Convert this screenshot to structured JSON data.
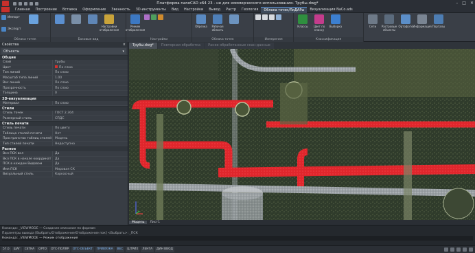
{
  "window": {
    "title": "Платформа nanoCAD x64 23 - не для коммерческого использования- Трубы.dwg*",
    "minimize": "–",
    "maximize": "□",
    "close": "✕"
  },
  "menu": {
    "tabs": [
      "Главная",
      "Построение",
      "Вставка",
      "Оформление",
      "Звенность",
      "3D-инструменты",
      "Вид",
      "Настройки",
      "Вывод",
      "Растр",
      "Геология",
      "Облака точек/ЛиДАРы",
      "Визуализация NaCo.ads"
    ],
    "active_index": 11
  },
  "ribbon": {
    "groups": [
      {
        "title": "Облака точек",
        "buttons": [
          "Импорт",
          "Экспорт",
          "Облако точек",
          "Менеджер облаков",
          "",
          ""
        ]
      },
      {
        "title": "Базовые вид",
        "buttons": [
          "Настройки отображения",
          "",
          "",
          ""
        ]
      },
      {
        "title": "Настройки",
        "buttons": [
          "Режим отображения",
          "",
          ""
        ]
      },
      {
        "title": "Облака точек",
        "buttons": [
          "Обрезка",
          "Рабочая область",
          "Сечения"
        ]
      },
      {
        "title": "Измерения",
        "buttons": [
          "",
          "",
          ""
        ]
      },
      {
        "title": "Классификация",
        "buttons": [
          "Классы",
          "Цвет по классу",
          "Выборка"
        ]
      },
      {
        "title": "",
        "buttons": [
          "Сети",
          "Растровые объекты",
          "Ортофото",
          "Информация",
          "Порталы"
        ]
      }
    ]
  },
  "properties": {
    "header": "Свойства",
    "selection": "Объекты",
    "selection_value": "Трубы",
    "sections": [
      {
        "title": "Общие",
        "rows": [
          {
            "key": "Слой",
            "value": "Трубы"
          },
          {
            "key": "Цвет",
            "value": "По слою"
          },
          {
            "key": "Тип линий",
            "value": "По слою"
          },
          {
            "key": "Масштаб типа линий",
            "value": "1.00"
          },
          {
            "key": "Вес линий",
            "value": "По слою"
          },
          {
            "key": "Прозрачность",
            "value": "По слою"
          },
          {
            "key": "Толщина",
            "value": "0"
          }
        ]
      },
      {
        "title": "3D-визуализация",
        "rows": [
          {
            "key": "Материал",
            "value": "По слою"
          }
        ]
      },
      {
        "title": "Стили",
        "rows": [
          {
            "key": "Стиль точек",
            "value": "ГОСТ 2.304"
          },
          {
            "key": "Размерный стиль",
            "value": "СПДС"
          }
        ]
      },
      {
        "title": "Стиль печати",
        "rows": [
          {
            "key": "Стиль печати",
            "value": "По цвету"
          },
          {
            "key": "Таблица стилей печати",
            "value": "Нет"
          },
          {
            "key": "Пространство таблиц стилей п...",
            "value": "Модель"
          },
          {
            "key": "Тип стилей печати",
            "value": "Недоступно"
          }
        ]
      },
      {
        "title": "Разное",
        "rows": [
          {
            "key": "Вкл ПСК вкл",
            "value": "Да"
          },
          {
            "key": "Вкл ПСК в начале координат",
            "value": "Да"
          },
          {
            "key": "ПСК в каждом Видовом",
            "value": "Да"
          },
          {
            "key": "Имя ПСК",
            "value": "Мировая СК"
          },
          {
            "key": "Визуальный стиль",
            "value": "Каркасный"
          }
        ]
      }
    ]
  },
  "doc_tabs": [
    "Трубы.dwg*",
    "Повторная обработка",
    "Ранее обработанные скан-данные"
  ],
  "layout_tabs": [
    "Модель",
    "Лист1"
  ],
  "command_lines": [
    "Команда: _VIEWMODE — Создание описания по формам",
    "Параметры вывода [Выбрать/Отображение/Отображение пок] <Выбрать>: _ПСК",
    "Команда: _VIEWMODE — Режим отображения"
  ],
  "status": [
    "57.0",
    "ШАГ",
    "СЕТКА",
    "ОРТО",
    "ОТС-ПОЛЯР",
    "ОТС-ОБЪЕКТ",
    "ПРИВЯЗКА",
    "ВЕС",
    "ШТРИХ",
    "ЛЕНТА",
    "ДИН ВВОД"
  ],
  "colors": {
    "accent": "#5d93d6",
    "pipe_red": "#e0262c",
    "brand": "#c8302c"
  }
}
